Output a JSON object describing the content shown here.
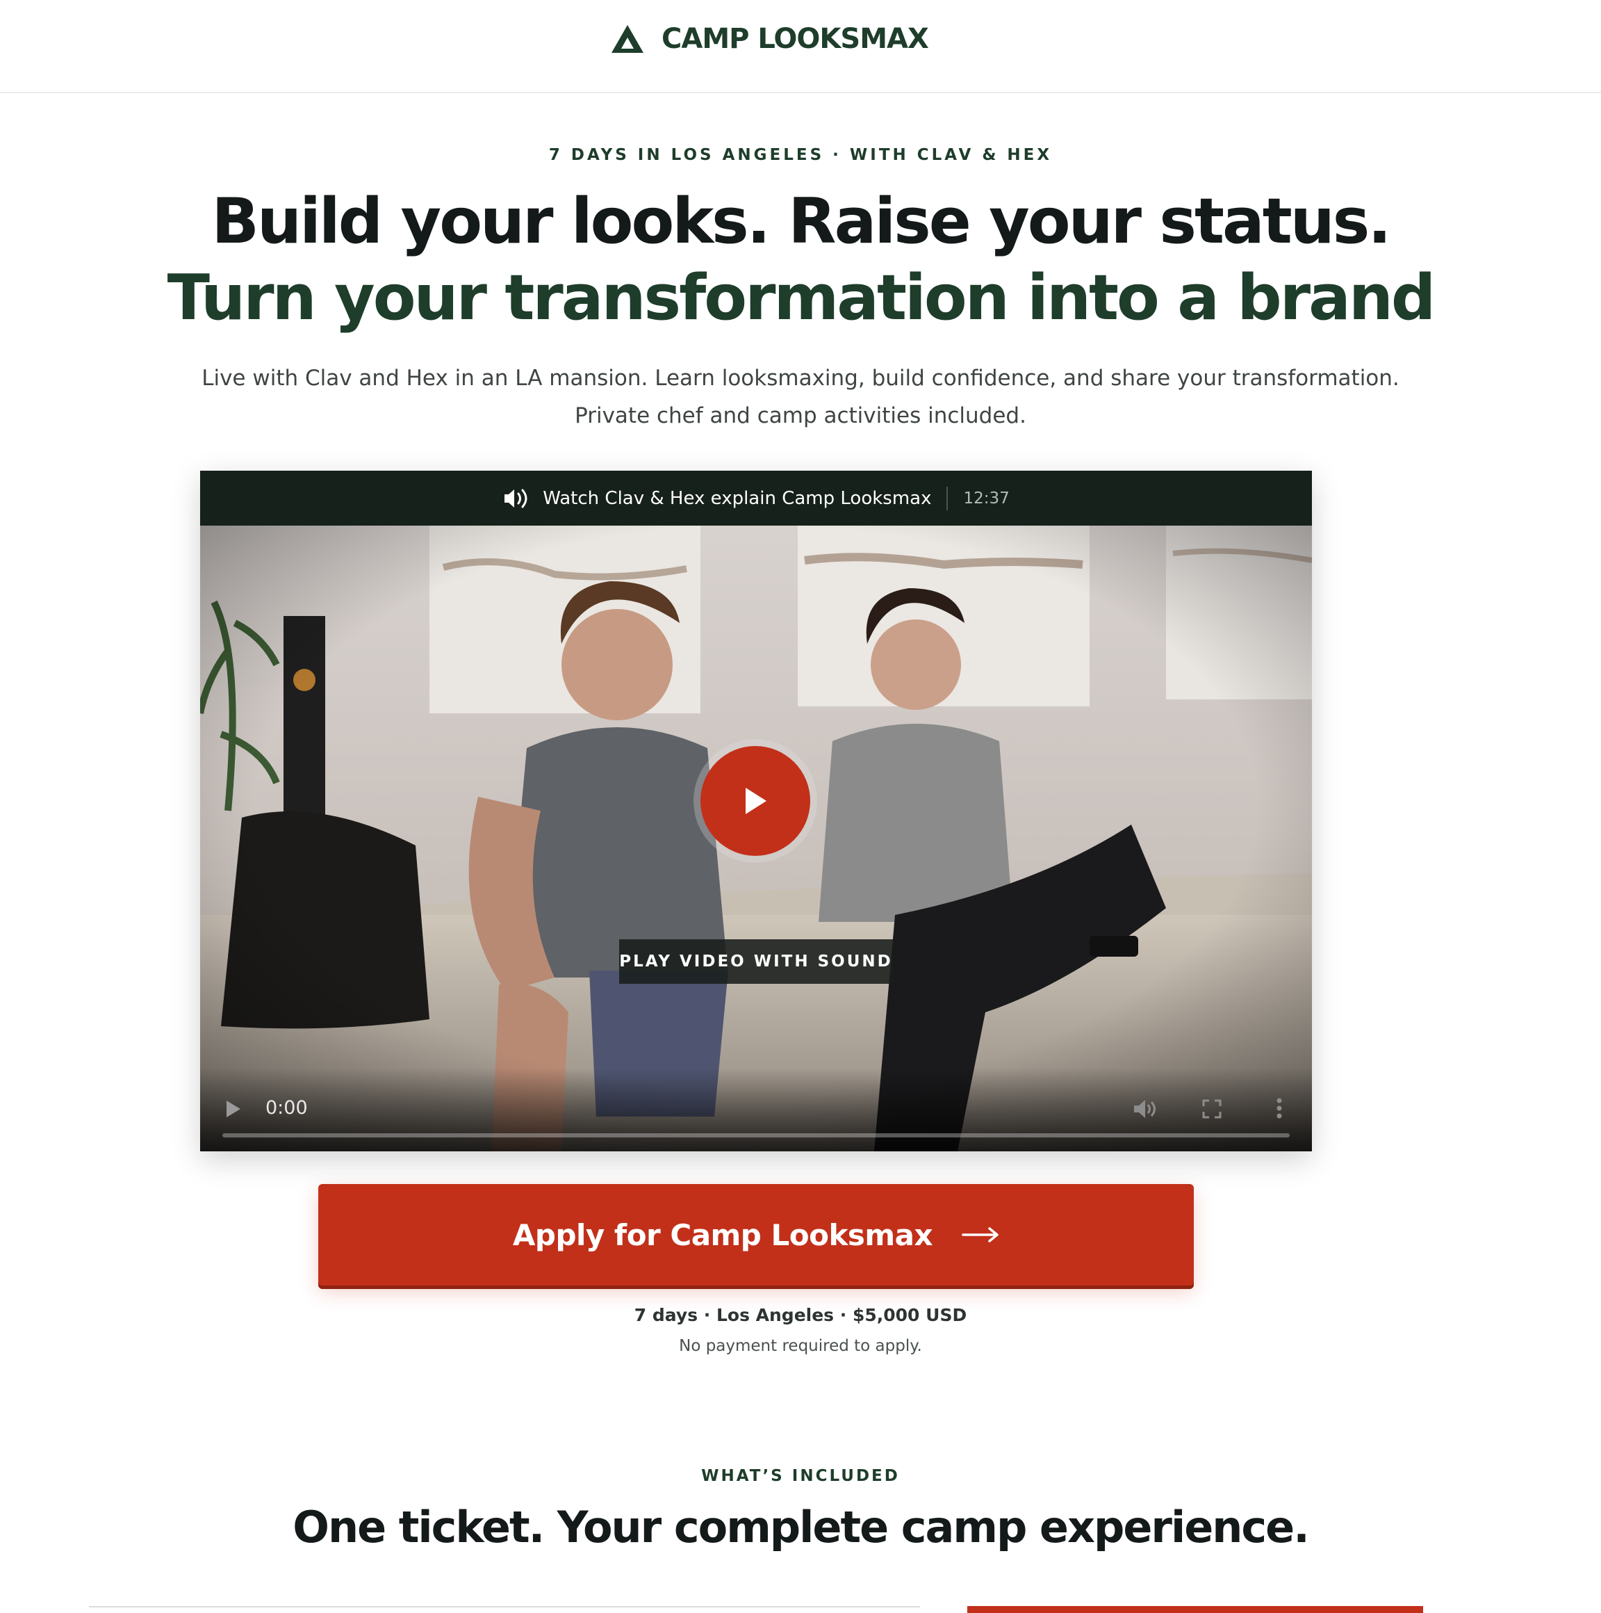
{
  "header": {
    "brand": "CAMP LOOKSMAX",
    "logo_icon": "triangle-tent-icon"
  },
  "hero": {
    "eyebrow": "7 DAYS IN LOS ANGELES · WITH CLAV & HEX",
    "headline_line1": "Build your looks. Raise your status.",
    "headline_line2": "Turn your transformation into a brand",
    "subcopy_line1": "Live with Clav and Hex in an LA mansion. Learn looksmaxing, build confidence, and share your transformation.",
    "subcopy_line2": "Private chef and camp activities included."
  },
  "video": {
    "title": "Watch Clav & Hex explain Camp Looksmax",
    "duration": "12:37",
    "play_overlay_label": "PLAY VIDEO WITH SOUND",
    "current_time": "0:00",
    "progress": 0
  },
  "cta": {
    "label": "Apply for Camp Looksmax",
    "meta_line": "7 days · Los Angeles · $5,000 USD",
    "note": "No payment required to apply."
  },
  "included": {
    "eyebrow": "WHAT’S INCLUDED",
    "title": "One ticket. Your complete camp experience."
  },
  "colors": {
    "brand_green": "#1e3d2b",
    "accent_red": "#c2301a",
    "topbar_dark": "#16211b"
  }
}
